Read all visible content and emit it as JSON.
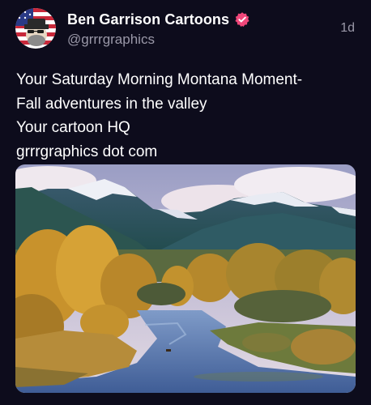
{
  "post": {
    "author": {
      "display_name": "Ben Garrison Cartoons",
      "handle": "@grrrgraphics",
      "verified": true,
      "avatar_icon": "user-avatar-cartoon"
    },
    "time": "1d",
    "body_lines": [
      "Your Saturday Morning Montana Moment-",
      "Fall adventures in the valley",
      "Your cartoon HQ",
      "grrrgraphics dot com"
    ],
    "media": {
      "kind": "photo",
      "subject": "autumn river valley with snow-capped mountains"
    }
  },
  "colors": {
    "background": "#0d0c1c",
    "text_primary": "#ffffff",
    "text_secondary": "#9a98a8",
    "verified_badge": "#f0477a"
  },
  "icons": {
    "verified": "verified-badge-icon"
  }
}
